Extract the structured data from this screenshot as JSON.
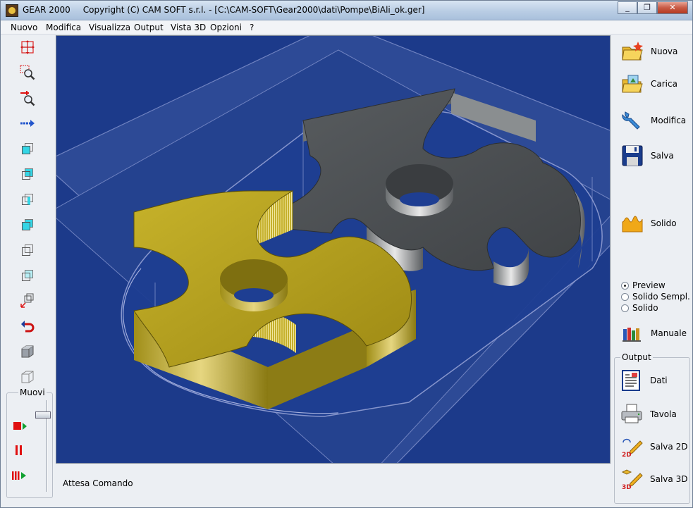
{
  "window": {
    "app_name": "GEAR 2000",
    "copyright": "Copyright (C)  CAM SOFT s.r.l. - [C:\\CAM-SOFT\\Gear2000\\dati\\Pompe\\BiAli_ok.ger]",
    "minimize": "_",
    "restore": "❐",
    "close": "✕"
  },
  "menu": [
    {
      "label": "Nuovo"
    },
    {
      "label": "Modifica"
    },
    {
      "label": "Visualizza"
    },
    {
      "label": "Output"
    },
    {
      "label": "Vista 3D"
    },
    {
      "label": "Opzioni"
    },
    {
      "label": "?"
    }
  ],
  "left_tools": [
    {
      "name": "pan-icon"
    },
    {
      "name": "zoom-window-icon"
    },
    {
      "name": "zoom-in-out-icon"
    },
    {
      "name": "arrow-right-icon"
    },
    {
      "name": "view-front-icon"
    },
    {
      "name": "view-top-icon"
    },
    {
      "name": "view-right-icon"
    },
    {
      "name": "view-left-icon"
    },
    {
      "name": "view-iso-icon"
    },
    {
      "name": "view-back-icon"
    },
    {
      "name": "rotate-axes-icon"
    },
    {
      "name": "undo-view-icon"
    },
    {
      "name": "solid-cube-icon"
    },
    {
      "name": "wire-cube-icon"
    }
  ],
  "muovi": {
    "label": "Muovi",
    "play_icon": "play-icon",
    "pause_icon": "pause-icon",
    "step_icon": "step-icon"
  },
  "status": {
    "text": "Attesa Comando"
  },
  "right_panel": {
    "nuova": "Nuova",
    "carica": "Carica",
    "modifica": "Modifica",
    "salva": "Salva",
    "solido": "Solido",
    "radio_preview": "Preview",
    "radio_solido_sempl": "Solido Sempl.",
    "radio_solido": "Solido",
    "radio_selected": "Preview",
    "manuale": "Manuale",
    "output_label": "Output",
    "dati": "Dati",
    "tavola": "Tavola",
    "salva2d": "Salva 2D",
    "salva3d": "Salva 3D",
    "badge_2d": "2D",
    "badge_3d": "3D"
  },
  "colors": {
    "viewport_bg": "#1c3a8a",
    "gear_gold": "#b8a021",
    "gear_gray": "#4d5153",
    "housing": "#5366a8"
  }
}
